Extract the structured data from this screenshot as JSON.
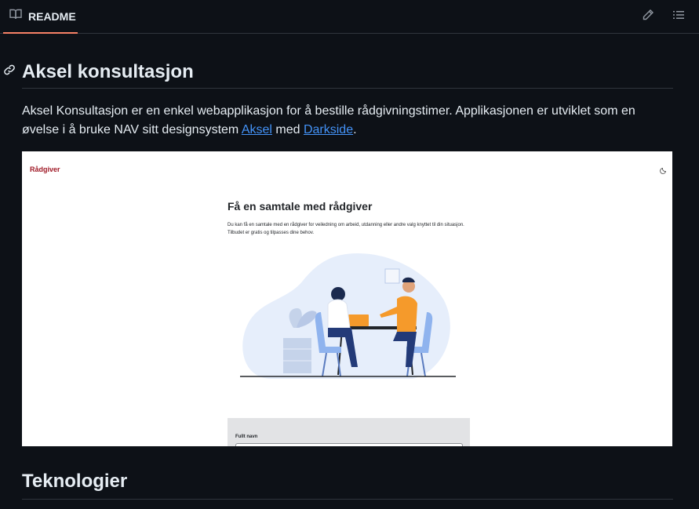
{
  "header": {
    "tab_label": "README",
    "tab_icon": "book-icon",
    "edit_icon": "pencil-icon",
    "outline_icon": "list-icon"
  },
  "readme": {
    "title": "Aksel konsultasjon",
    "anchor_icon": "link-icon",
    "intro_text_1": "Aksel Konsultasjon er en enkel webapplikasjon for å bestille rådgivningstimer. Applikasjonen er utviklet som en øvelse i å bruke NAV sitt designsystem ",
    "link_aksel": "Aksel",
    "intro_text_2": " med ",
    "link_darkside": "Darkside",
    "intro_text_3": ".",
    "screenshot": {
      "brand": "Rådgiver",
      "title": "Få en samtale med rådgiver",
      "description": "Du kan få en samtale med en rådgiver for veiledning om arbeid, utdanning eller andre valg knyttet til din situasjon. Tilbudet er gratis og tilpasses dine behov.",
      "field_label": "Fullt navn",
      "brand_color": "#a01a27"
    },
    "section2_title": "Teknologier"
  },
  "colors": {
    "background": "#0d1117",
    "text": "#e6edf3",
    "link": "#4493f8",
    "border": "#30363d",
    "tab_accent": "#f78166"
  }
}
